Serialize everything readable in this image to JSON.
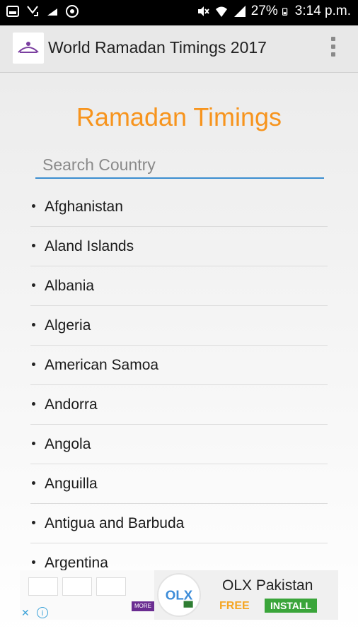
{
  "status_bar": {
    "battery": "27%",
    "time": "3:14 p.m.",
    "left_icons": [
      "gallery-icon",
      "missed-call-icon",
      "cloud-icon",
      "whatsapp-icon"
    ],
    "right_icons": [
      "mute-icon",
      "wifi-icon",
      "signal-icon",
      "battery-icon"
    ]
  },
  "app_bar": {
    "title": "World Ramadan Timings 2017",
    "logo_icon": "app-logo-icon",
    "menu_icon": "overflow-menu-icon"
  },
  "main": {
    "heading": "Ramadan Timings",
    "heading_color": "#f7941d",
    "search": {
      "placeholder": "Search Country",
      "value": ""
    },
    "countries": [
      "Afghanistan",
      "Aland Islands",
      "Albania",
      "Algeria",
      "American Samoa",
      "Andorra",
      "Angola",
      "Anguilla",
      "Antigua and Barbuda",
      "Argentina"
    ]
  },
  "ad": {
    "title": "OLX Pakistan",
    "free_label": "FREE",
    "install_label": "INSTALL",
    "more_label": "MORE",
    "logo_text": "OLX",
    "accent_free": "#f5a623",
    "accent_install": "#3aa53a"
  }
}
